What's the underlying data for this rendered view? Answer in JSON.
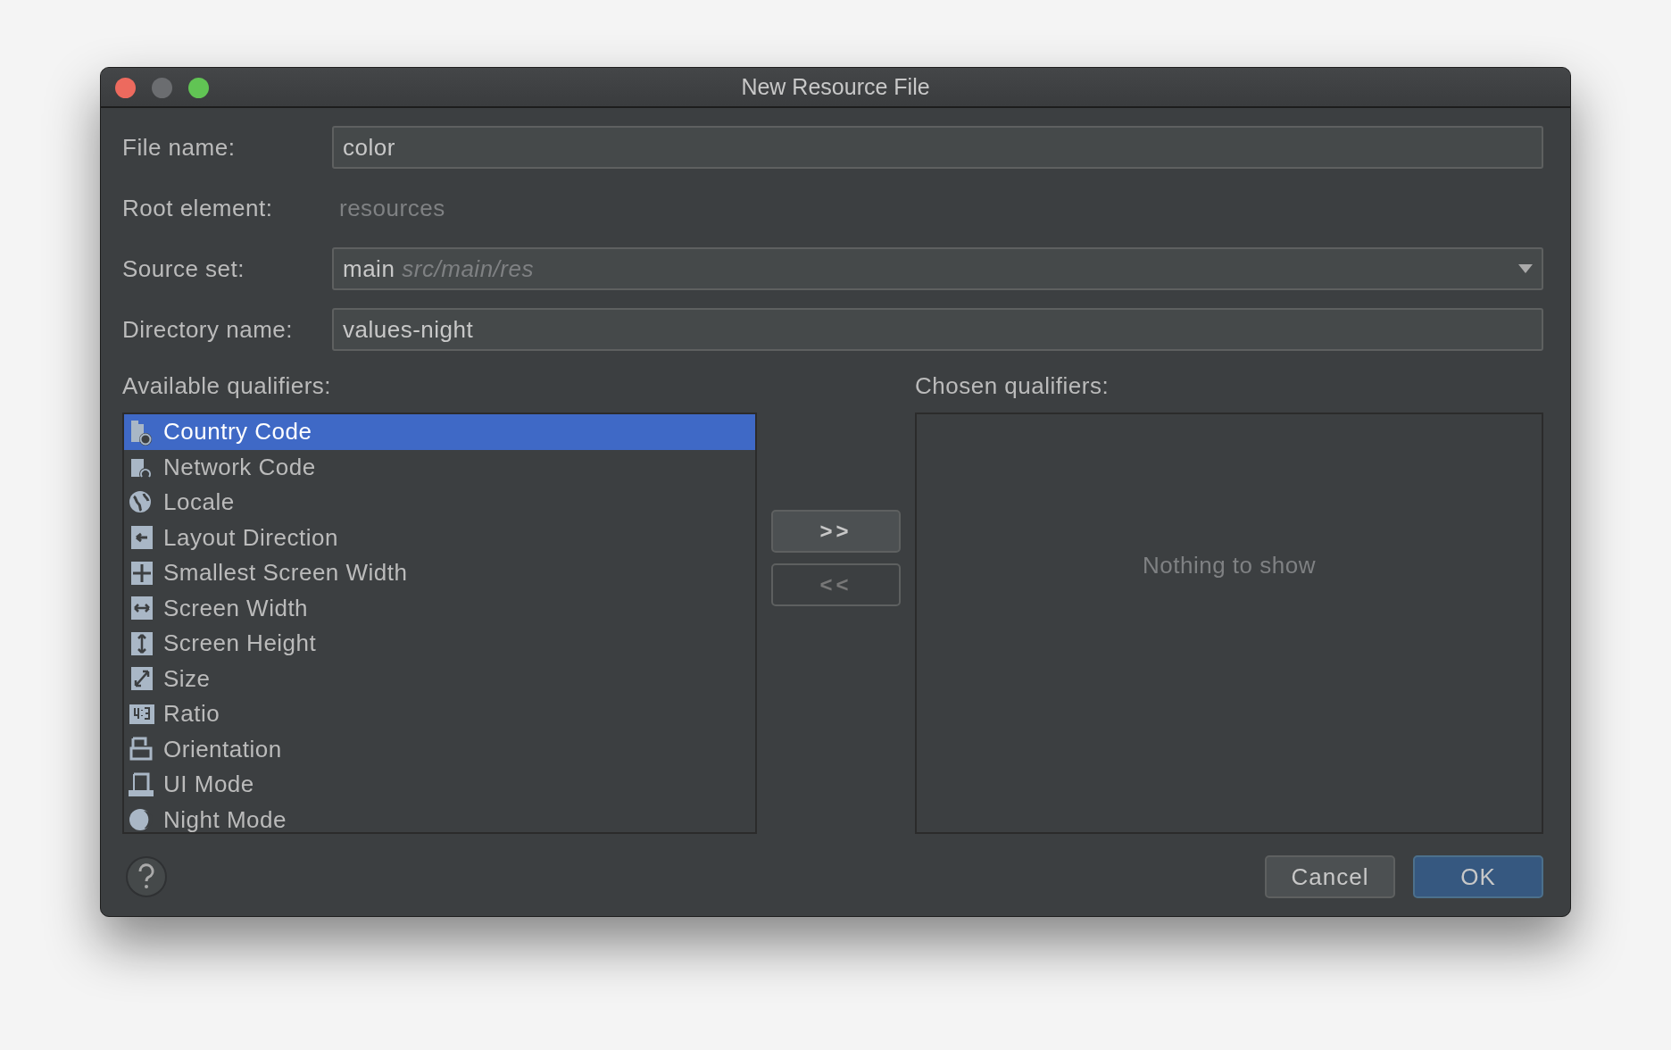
{
  "window": {
    "title": "New Resource File"
  },
  "form": [
    {
      "kind": "field",
      "label": "File name:",
      "value": "color"
    },
    {
      "kind": "static",
      "label": "Root element:",
      "value": "resources"
    },
    {
      "kind": "dropdown",
      "label": "Source set:",
      "value": "main",
      "hint": "src/main/res"
    },
    {
      "kind": "field",
      "label": "Directory name:",
      "value": "values-night"
    }
  ],
  "available_qualifiers": {
    "label": "Available qualifiers:",
    "items": [
      {
        "label": "Country Code",
        "selected": true
      },
      {
        "label": "Network Code",
        "selected": false
      },
      {
        "label": "Locale",
        "selected": false
      },
      {
        "label": "Layout Direction",
        "selected": false
      },
      {
        "label": "Smallest Screen Width",
        "selected": false
      },
      {
        "label": "Screen Width",
        "selected": false
      },
      {
        "label": "Screen Height",
        "selected": false
      },
      {
        "label": "Size",
        "selected": false
      },
      {
        "label": "Ratio",
        "selected": false
      },
      {
        "label": "Orientation",
        "selected": false
      },
      {
        "label": "UI Mode",
        "selected": false
      },
      {
        "label": "Night Mode",
        "selected": false
      }
    ]
  },
  "move_buttons": [
    {
      "label": ">>",
      "disabled": false
    },
    {
      "label": "<<",
      "disabled": true
    }
  ],
  "chosen_qualifiers": {
    "label": "Chosen qualifiers:",
    "empty_text": "Nothing to show"
  },
  "buttons": [
    {
      "label": "Cancel",
      "kind": "secondary"
    },
    {
      "label": "OK",
      "kind": "primary"
    }
  ]
}
